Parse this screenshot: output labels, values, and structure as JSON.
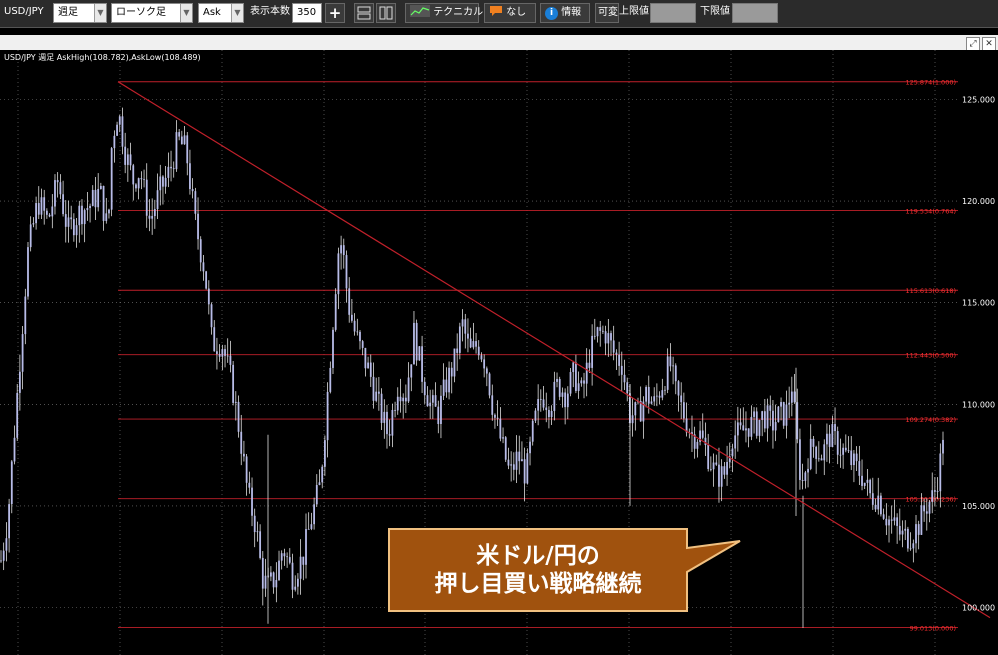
{
  "toolbar": {
    "pair": "USD/JPY",
    "period": "週足",
    "chart_type": "ローソク足",
    "price_type": "Ask",
    "count_label": "表示本数",
    "count_value": "350",
    "add_symbol": "+",
    "technical_label": "テクニカル",
    "comment_label": "なし",
    "info_icon": "i",
    "info_label": "情報",
    "variable_label": "可変",
    "upper_label": "上限値",
    "lower_label": "下限値"
  },
  "header_icons": [
    "expand-icon",
    "close-icon"
  ],
  "callout": {
    "line1": "米ドル/円の",
    "line2": "押し目買い戦略継続"
  },
  "colors": {
    "background": "#000000",
    "grid": "#808080",
    "fib": "#c0202a",
    "trend": "#c0202a",
    "candle_body": "#b8bce8",
    "candle_wick": "#ffffff",
    "callout_fill": "#a0520e",
    "callout_border": "#f0c080"
  },
  "chart_data": {
    "type": "candlestick",
    "title": "USD/JPY 週足 AskHigh(108.782),AskLow(108.489)",
    "ylim": [
      99.0,
      126.5
    ],
    "yticks": [
      100.0,
      105.0,
      110.0,
      115.0,
      120.0,
      125.0
    ],
    "ytick_labels": [
      "100.000",
      "105.000",
      "110.000",
      "115.000",
      "120.000",
      "125.000"
    ],
    "grid": true,
    "x_count": 350,
    "price_path": [
      [
        0,
        102.0
      ],
      [
        8,
        104.5
      ],
      [
        18,
        111.0
      ],
      [
        28,
        117.5
      ],
      [
        38,
        120.0
      ],
      [
        48,
        119.0
      ],
      [
        58,
        121.0
      ],
      [
        68,
        118.5
      ],
      [
        80,
        119.5
      ],
      [
        90,
        119.8
      ],
      [
        100,
        120.5
      ],
      [
        108,
        118.5
      ],
      [
        112,
        123.0
      ],
      [
        118,
        124.5
      ],
      [
        125,
        122.5
      ],
      [
        133,
        121.0
      ],
      [
        140,
        121.5
      ],
      [
        150,
        119.0
      ],
      [
        160,
        120.5
      ],
      [
        170,
        121.5
      ],
      [
        178,
        123.0
      ],
      [
        186,
        122.5
      ],
      [
        195,
        119.0
      ],
      [
        205,
        116.5
      ],
      [
        212,
        113.0
      ],
      [
        222,
        113.0
      ],
      [
        232,
        111.0
      ],
      [
        240,
        108.5
      ],
      [
        248,
        105.5
      ],
      [
        256,
        104.0
      ],
      [
        262,
        101.5
      ],
      [
        268,
        101.0
      ],
      [
        276,
        101.5
      ],
      [
        283,
        103.0
      ],
      [
        293,
        101.5
      ],
      [
        303,
        102.5
      ],
      [
        312,
        104.5
      ],
      [
        320,
        106.0
      ],
      [
        326,
        109.5
      ],
      [
        332,
        113.5
      ],
      [
        338,
        117.5
      ],
      [
        342,
        118.0
      ],
      [
        348,
        115.0
      ],
      [
        355,
        113.5
      ],
      [
        362,
        112.5
      ],
      [
        370,
        111.5
      ],
      [
        378,
        110.0
      ],
      [
        388,
        108.5
      ],
      [
        398,
        111.0
      ],
      [
        406,
        110.5
      ],
      [
        414,
        113.5
      ],
      [
        422,
        111.5
      ],
      [
        430,
        110.0
      ],
      [
        438,
        109.5
      ],
      [
        446,
        111.0
      ],
      [
        454,
        112.0
      ],
      [
        462,
        114.0
      ],
      [
        470,
        112.5
      ],
      [
        478,
        113.0
      ],
      [
        486,
        112.0
      ],
      [
        494,
        109.5
      ],
      [
        502,
        108.0
      ],
      [
        510,
        106.5
      ],
      [
        518,
        107.5
      ],
      [
        526,
        106.5
      ],
      [
        534,
        109.0
      ],
      [
        542,
        110.5
      ],
      [
        550,
        110.0
      ],
      [
        558,
        111.0
      ],
      [
        566,
        110.5
      ],
      [
        574,
        111.5
      ],
      [
        582,
        110.5
      ],
      [
        590,
        112.5
      ],
      [
        598,
        113.5
      ],
      [
        606,
        113.5
      ],
      [
        614,
        112.5
      ],
      [
        622,
        112.0
      ],
      [
        630,
        109.5
      ],
      [
        638,
        109.5
      ],
      [
        646,
        110.5
      ],
      [
        654,
        110.0
      ],
      [
        662,
        111.0
      ],
      [
        670,
        112.0
      ],
      [
        676,
        110.5
      ],
      [
        684,
        109.5
      ],
      [
        692,
        108.5
      ],
      [
        700,
        108.5
      ],
      [
        708,
        107.5
      ],
      [
        716,
        106.5
      ],
      [
        724,
        106.5
      ],
      [
        732,
        108.5
      ],
      [
        740,
        108.5
      ],
      [
        748,
        109.0
      ],
      [
        756,
        109.0
      ],
      [
        764,
        109.5
      ],
      [
        772,
        109.0
      ],
      [
        780,
        109.5
      ],
      [
        786,
        109.5
      ],
      [
        792,
        111.0
      ],
      [
        798,
        107.5
      ],
      [
        802,
        106.0
      ],
      [
        808,
        107.5
      ],
      [
        814,
        108.0
      ],
      [
        822,
        107.5
      ],
      [
        830,
        108.5
      ],
      [
        838,
        108.0
      ],
      [
        846,
        107.5
      ],
      [
        854,
        107.0
      ],
      [
        862,
        106.5
      ],
      [
        870,
        105.5
      ],
      [
        878,
        105.5
      ],
      [
        886,
        104.5
      ],
      [
        894,
        104.0
      ],
      [
        902,
        103.5
      ],
      [
        910,
        103.5
      ],
      [
        918,
        104.0
      ],
      [
        926,
        105.0
      ],
      [
        934,
        105.5
      ],
      [
        940,
        107.0
      ],
      [
        943,
        108.6
      ]
    ],
    "fibonacci": {
      "x_start": 118,
      "levels": [
        {
          "value": 125.874,
          "ratio": "1.000",
          "label": "125.874(1.000)"
        },
        {
          "value": 119.534,
          "ratio": "0.764",
          "label": "119.534(0.764)"
        },
        {
          "value": 115.613,
          "ratio": "0.618",
          "label": "115.613(0.618)"
        },
        {
          "value": 112.443,
          "ratio": "0.500",
          "label": "112.443(0.500)"
        },
        {
          "value": 109.274,
          "ratio": "0.382",
          "label": "109.274(0.382)"
        },
        {
          "value": 105.353,
          "ratio": "0.236",
          "label": "105.353(0.236)"
        },
        {
          "value": 99.013,
          "ratio": "0.000",
          "label": "99.013(0.000)"
        }
      ]
    },
    "trendline": {
      "x1": 118,
      "y1": 125.874,
      "x2": 990,
      "y2": 99.5
    }
  }
}
